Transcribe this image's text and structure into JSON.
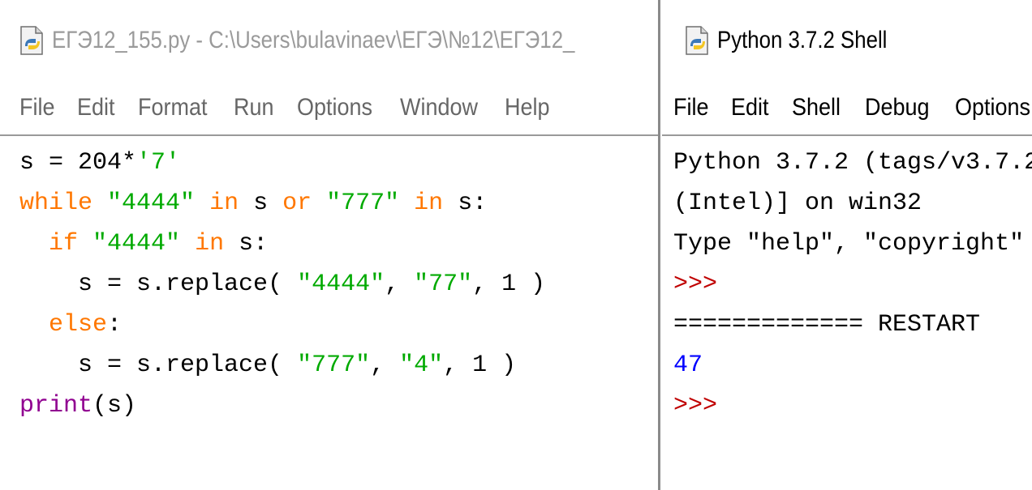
{
  "editor": {
    "title": "ЕГЭ12_155.py - C:\\Users\\bulavinaev\\ЕГЭ\\№12\\ЕГЭ12_",
    "menu": [
      "File",
      "Edit",
      "Format",
      "Run",
      "Options",
      "Window",
      "Help"
    ],
    "code": {
      "line1": {
        "t1": "s = 204*",
        "t2": "'7'"
      },
      "line2": {
        "t1": "while",
        "t2": " ",
        "t3": "\"4444\"",
        "t4": " ",
        "t5": "in",
        "t6": " s ",
        "t7": "or",
        "t8": " ",
        "t9": "\"777\"",
        "t10": " ",
        "t11": "in",
        "t12": " s:"
      },
      "line3": {
        "t1": "  ",
        "t2": "if",
        "t3": " ",
        "t4": "\"4444\"",
        "t5": " ",
        "t6": "in",
        "t7": " s:"
      },
      "line4": {
        "t1": "    s = s.replace( ",
        "t2": "\"4444\"",
        "t3": ", ",
        "t4": "\"77\"",
        "t5": ", 1 )"
      },
      "line5": {
        "t1": "  ",
        "t2": "else",
        "t3": ":"
      },
      "line6": {
        "t1": "    s = s.replace( ",
        "t2": "\"777\"",
        "t3": ", ",
        "t4": "\"4\"",
        "t5": ", 1 )"
      },
      "line7": {
        "t1": "print",
        "t2": "(s)"
      }
    }
  },
  "shell": {
    "title": "Python 3.7.2 Shell",
    "menu": [
      "File",
      "Edit",
      "Shell",
      "Debug",
      "Options"
    ],
    "lines": {
      "banner1": "Python 3.7.2 (tags/v3.7.2",
      "banner2": "(Intel)] on win32",
      "banner3": "Type \"help\", \"copyright\"",
      "prompt1": ">>>",
      "restart": "============= RESTART",
      "result": "47",
      "prompt2": ">>>"
    }
  },
  "icons": {
    "editor_app": "python-idle-icon",
    "shell_app": "python-idle-icon"
  },
  "colors": {
    "keyword": "#ff7700",
    "string": "#00aa00",
    "builtin": "#900090",
    "result": "#0000ff",
    "prompt": "#c00000"
  }
}
